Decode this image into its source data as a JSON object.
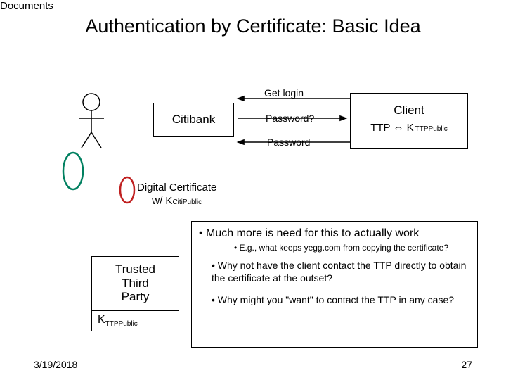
{
  "title": "Authentication by Certificate: Basic Idea",
  "entities": {
    "server": "Citibank",
    "client": "Client",
    "client_key": {
      "prefix": "TTP ⇔ K",
      "sub": "TTPPublic"
    },
    "documents_label": "Documents"
  },
  "messages": {
    "get_login": "Get login",
    "password_q": "Password?",
    "password": "Password"
  },
  "digital_cert": {
    "line1": "Digital Certificate",
    "line2_prefix": "w/ K",
    "line2_sub": "CitiPublic"
  },
  "ttp": {
    "label_l1": "Trusted",
    "label_l2": "Third",
    "label_l3": "Party",
    "key_prefix": "K",
    "key_sub": "TTPPublic"
  },
  "bullets": {
    "main": "• Much more is need for this to actually work",
    "sub1": "• E.g., what keeps yegg.com from copying the certificate?",
    "q1": "• Why not have the client contact the TTP directly to obtain the certificate at the outset?",
    "q2": "• Why might you \"want\" to contact the TTP in any case?"
  },
  "footer": {
    "date": "3/19/2018",
    "page": "27"
  }
}
